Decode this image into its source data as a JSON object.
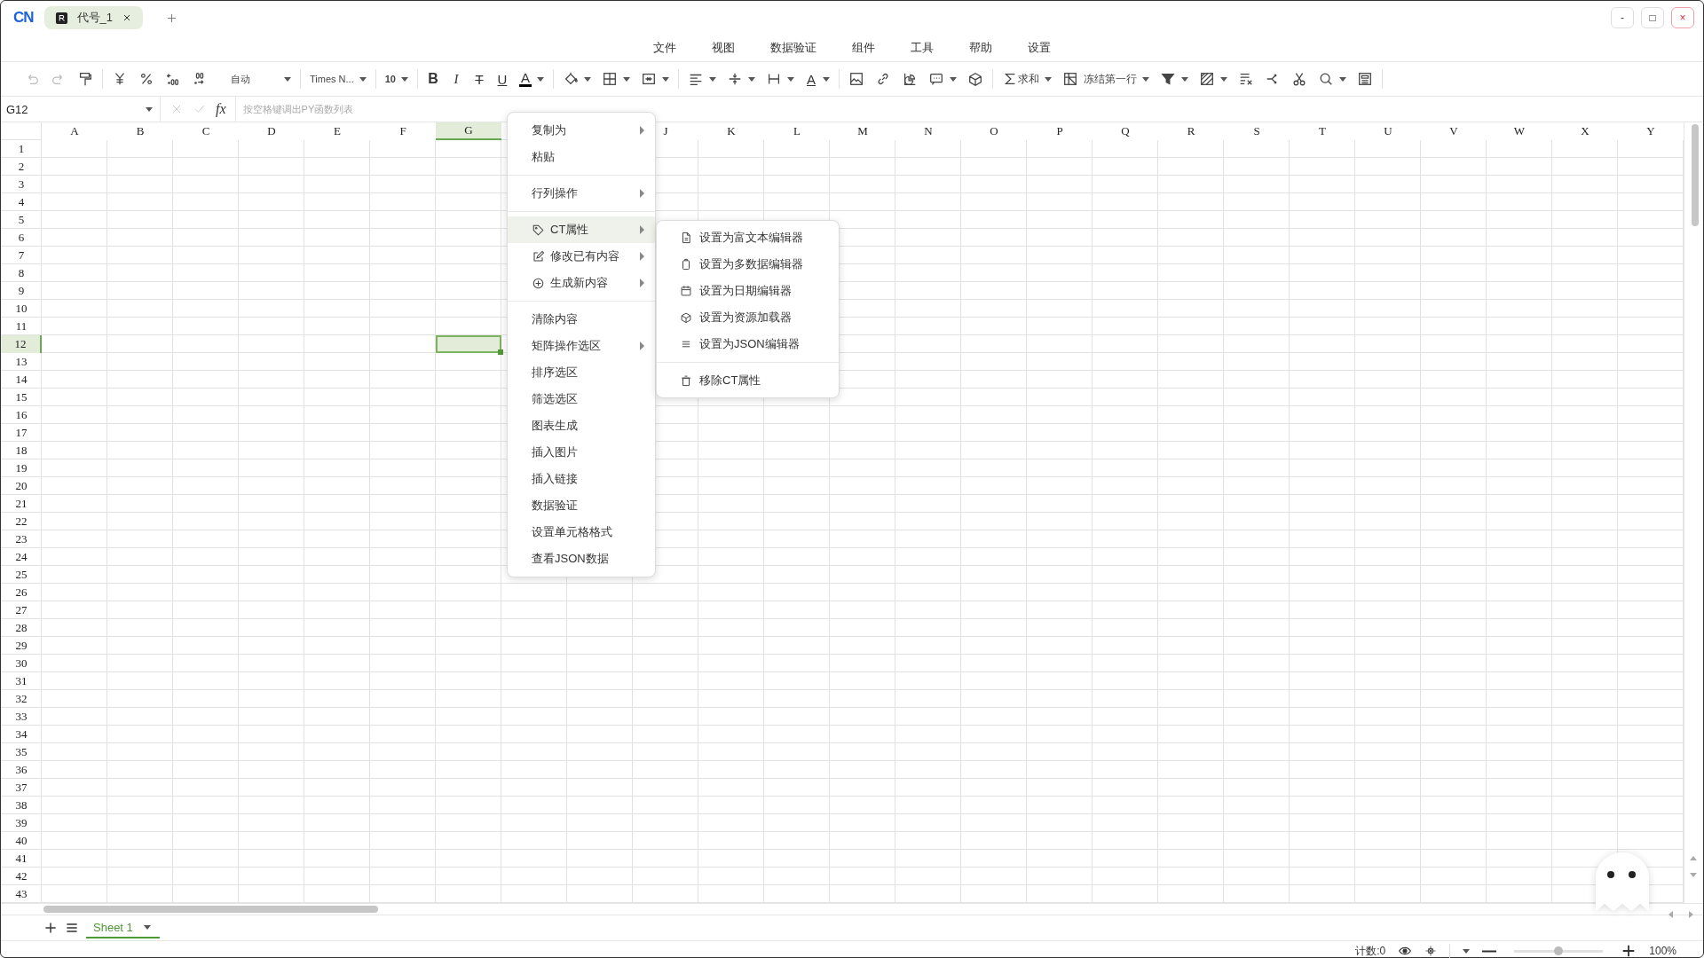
{
  "app_logo": "CN",
  "document_tabs": [
    {
      "label": "代号_1",
      "selected": true
    }
  ],
  "window_controls": [
    "-",
    "□",
    "×"
  ],
  "menu_bar": [
    "文件",
    "视图",
    "数据验证",
    "组件",
    "工具",
    "帮助",
    "设置"
  ],
  "toolbar": {
    "undo": {
      "disabled": true
    },
    "redo": {
      "disabled": true
    },
    "number_format": "自动",
    "font_family": "Times N...",
    "font_size": "10",
    "text_styles": [
      {
        "kind": "bold",
        "label": "B"
      },
      {
        "kind": "italic",
        "label": "I"
      },
      {
        "kind": "strike",
        "label": "T"
      },
      {
        "kind": "underline",
        "label": "U"
      },
      {
        "kind": "font_color",
        "label": "A"
      }
    ],
    "text_direction": "A",
    "sum_label": "求和",
    "freeze_label": "冻结第一行"
  },
  "formula_bar": {
    "cell_ref": "G12",
    "fx": "fx",
    "placeholder": "按空格键调出PY函数列表"
  },
  "grid": {
    "columns_before_menu": [
      {
        "label": "A",
        "selected": false
      },
      {
        "label": "B",
        "selected": false
      },
      {
        "label": "C",
        "selected": false
      },
      {
        "label": "D",
        "selected": false
      },
      {
        "label": "E",
        "selected": false
      },
      {
        "label": "F",
        "selected": false
      },
      {
        "label": "G",
        "selected": true
      }
    ],
    "columns_after_menu": [
      {
        "label": "J",
        "selected": false
      },
      {
        "label": "K",
        "selected": false
      },
      {
        "label": "L",
        "selected": false
      },
      {
        "label": "M",
        "selected": false
      },
      {
        "label": "N",
        "selected": false
      },
      {
        "label": "O",
        "selected": false
      },
      {
        "label": "P",
        "selected": false
      },
      {
        "label": "Q",
        "selected": false
      },
      {
        "label": "R",
        "selected": false
      },
      {
        "label": "S",
        "selected": false
      },
      {
        "label": "T",
        "selected": false
      },
      {
        "label": "U",
        "selected": false
      },
      {
        "label": "V",
        "selected": false
      },
      {
        "label": "W",
        "selected": false
      },
      {
        "label": "X",
        "selected": false
      },
      {
        "label": "Y",
        "selected": false
      }
    ],
    "rows": [
      {
        "label": "1",
        "selected": false
      },
      {
        "label": "2",
        "selected": false
      },
      {
        "label": "3",
        "selected": false
      },
      {
        "label": "4",
        "selected": false
      },
      {
        "label": "5",
        "selected": false
      },
      {
        "label": "6",
        "selected": false
      },
      {
        "label": "7",
        "selected": false
      },
      {
        "label": "8",
        "selected": false
      },
      {
        "label": "9",
        "selected": false
      },
      {
        "label": "10",
        "selected": false
      },
      {
        "label": "11",
        "selected": false
      },
      {
        "label": "12",
        "selected": true
      },
      {
        "label": "13",
        "selected": false
      },
      {
        "label": "14",
        "selected": false
      },
      {
        "label": "15",
        "selected": false
      },
      {
        "label": "16",
        "selected": false
      },
      {
        "label": "17",
        "selected": false
      },
      {
        "label": "18",
        "selected": false
      },
      {
        "label": "19",
        "selected": false
      },
      {
        "label": "20",
        "selected": false
      },
      {
        "label": "21",
        "selected": false
      },
      {
        "label": "22",
        "selected": false
      },
      {
        "label": "23",
        "selected": false
      },
      {
        "label": "24",
        "selected": false
      },
      {
        "label": "25",
        "selected": false
      },
      {
        "label": "26",
        "selected": false
      },
      {
        "label": "27",
        "selected": false
      },
      {
        "label": "28",
        "selected": false
      },
      {
        "label": "29",
        "selected": false
      },
      {
        "label": "30",
        "selected": false
      },
      {
        "label": "31",
        "selected": false
      },
      {
        "label": "32",
        "selected": false
      },
      {
        "label": "33",
        "selected": false
      },
      {
        "label": "34",
        "selected": false
      },
      {
        "label": "35",
        "selected": false
      },
      {
        "label": "36",
        "selected": false
      },
      {
        "label": "37",
        "selected": false
      },
      {
        "label": "38",
        "selected": false
      },
      {
        "label": "39",
        "selected": false
      },
      {
        "label": "40",
        "selected": false
      },
      {
        "label": "41",
        "selected": false
      },
      {
        "label": "42",
        "selected": false
      },
      {
        "label": "43",
        "selected": false
      }
    ]
  },
  "context_menu": {
    "items": [
      {
        "kind": "plain",
        "label": "复制为",
        "submenu": true,
        "selected": false
      },
      {
        "kind": "plain",
        "label": "粘贴",
        "submenu": false,
        "selected": false
      },
      {
        "kind": "divider"
      },
      {
        "kind": "plain",
        "label": "行列操作",
        "submenu": true,
        "selected": false
      },
      {
        "kind": "divider"
      },
      {
        "kind": "tag",
        "label": "CT属性",
        "submenu": true,
        "selected": true
      },
      {
        "kind": "edit",
        "label": "修改已有内容",
        "submenu": true,
        "selected": false
      },
      {
        "kind": "add",
        "label": "生成新内容",
        "submenu": true,
        "selected": false
      },
      {
        "kind": "divider"
      },
      {
        "kind": "plain",
        "label": "清除内容",
        "submenu": false,
        "selected": false
      },
      {
        "kind": "plain",
        "label": "矩阵操作选区",
        "submenu": true,
        "selected": false
      },
      {
        "kind": "plain",
        "label": "排序选区",
        "submenu": false,
        "selected": false
      },
      {
        "kind": "plain",
        "label": "筛选选区",
        "submenu": false,
        "selected": false
      },
      {
        "kind": "plain",
        "label": "图表生成",
        "submenu": false,
        "selected": false
      },
      {
        "kind": "plain",
        "label": "插入图片",
        "submenu": false,
        "selected": false
      },
      {
        "kind": "plain",
        "label": "插入链接",
        "submenu": false,
        "selected": false
      },
      {
        "kind": "plain",
        "label": "数据验证",
        "submenu": false,
        "selected": false
      },
      {
        "kind": "plain",
        "label": "设置单元格格式",
        "submenu": false,
        "selected": false
      },
      {
        "kind": "plain",
        "label": "查看JSON数据",
        "submenu": false,
        "selected": false
      }
    ]
  },
  "submenu": {
    "items": [
      {
        "kind": "document",
        "label": "设置为富文本编辑器"
      },
      {
        "kind": "clipboard",
        "label": "设置为多数据编辑器"
      },
      {
        "kind": "calendar",
        "label": "设置为日期编辑器"
      },
      {
        "kind": "cube",
        "label": "设置为资源加载器"
      },
      {
        "kind": "lines",
        "label": "设置为JSON编辑器"
      },
      {
        "kind": "divider"
      },
      {
        "kind": "trash",
        "label": "移除CT属性"
      }
    ]
  },
  "sheet_tabs": [
    {
      "label": "Sheet 1",
      "selected": true
    }
  ],
  "status_bar": {
    "count": "计数:0",
    "zoom": {
      "level": 0.5
    },
    "zoom_label": "100%"
  }
}
